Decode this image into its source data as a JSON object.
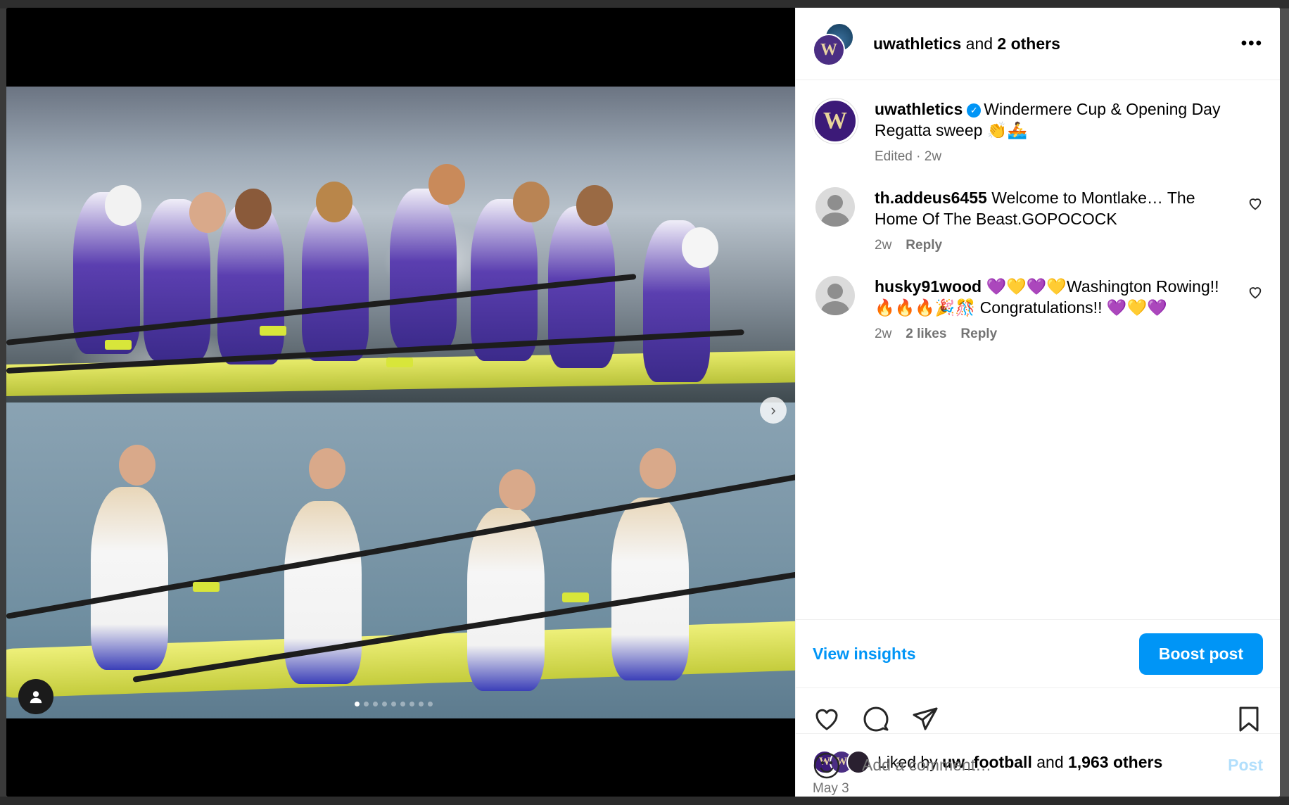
{
  "header": {
    "username": "uwathletics",
    "and_text": "and",
    "others": "2 others"
  },
  "caption": {
    "username": "uwathletics",
    "text": "Windermere Cup & Opening Day Regatta sweep 👏🚣",
    "edited": "Edited",
    "time": "2w",
    "avatar_letter": "W"
  },
  "comments": [
    {
      "username": "th.addeus6455",
      "text": "Welcome to Montlake… The Home Of The Beast.GOPOCOCK",
      "time": "2w",
      "likes": "",
      "reply": "Reply"
    },
    {
      "username": "husky91wood",
      "text": "💜💛💜💛Washington Rowing!! 🔥🔥🔥🎉🎊 Congratulations!! 💜💛💜",
      "time": "2w",
      "likes": "2 likes",
      "reply": "Reply"
    }
  ],
  "insights": {
    "view_label": "View insights",
    "boost_label": "Boost post"
  },
  "likes": {
    "prefix": "Liked by",
    "user": "uw_football",
    "and_text": "and",
    "count": "1,963 others"
  },
  "post_date": "May 3",
  "comment_box": {
    "placeholder": "Add a comment…",
    "post_label": "Post"
  },
  "carousel": {
    "total_slides": 9,
    "active_slide": 1
  },
  "colors": {
    "accent": "#0095f6",
    "uw_purple": "#3c1a78",
    "uw_gold": "#e9d59a"
  }
}
